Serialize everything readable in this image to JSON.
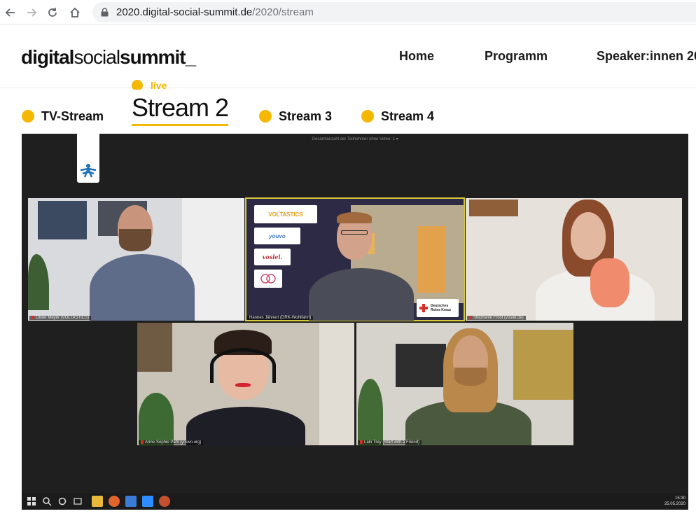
{
  "browser": {
    "url_host": "2020.digital-social-summit.de",
    "url_path": "/2020/stream"
  },
  "site": {
    "logo": {
      "part1": "digital",
      "part2": "social",
      "part3": "summit_"
    },
    "nav": [
      "Home",
      "Programm",
      "Speaker:innen 20"
    ]
  },
  "streams": {
    "live_label": "live",
    "tabs": [
      "TV-Stream",
      "Stream 2",
      "Stream 3",
      "Stream 4"
    ],
    "active_index": 1
  },
  "video": {
    "top_caption": "Gesamtanzahl der Teilnehmer ohne Video: 1  ▾",
    "participants": [
      "Oliver Meyer (VOLTASTICS)",
      "Hannes Jähnert (DRK-Wohlfahrt)",
      "Stephanie Frost (voslel.de)",
      "Anne-Sophie Pahl (youvo.org)",
      "Lalo Trey (Start with a Friend)"
    ],
    "sponsors": [
      "VOLTASTICS",
      "youvo",
      "voslel.",
      "Deutsches Rotes Kreuz"
    ],
    "taskbar_time": "15:30",
    "taskbar_date": "25.05.2020"
  },
  "colors": {
    "accent": "#f5b800",
    "video_bg": "#1f1f1f",
    "active_speaker_outline": "#d6c93a"
  }
}
